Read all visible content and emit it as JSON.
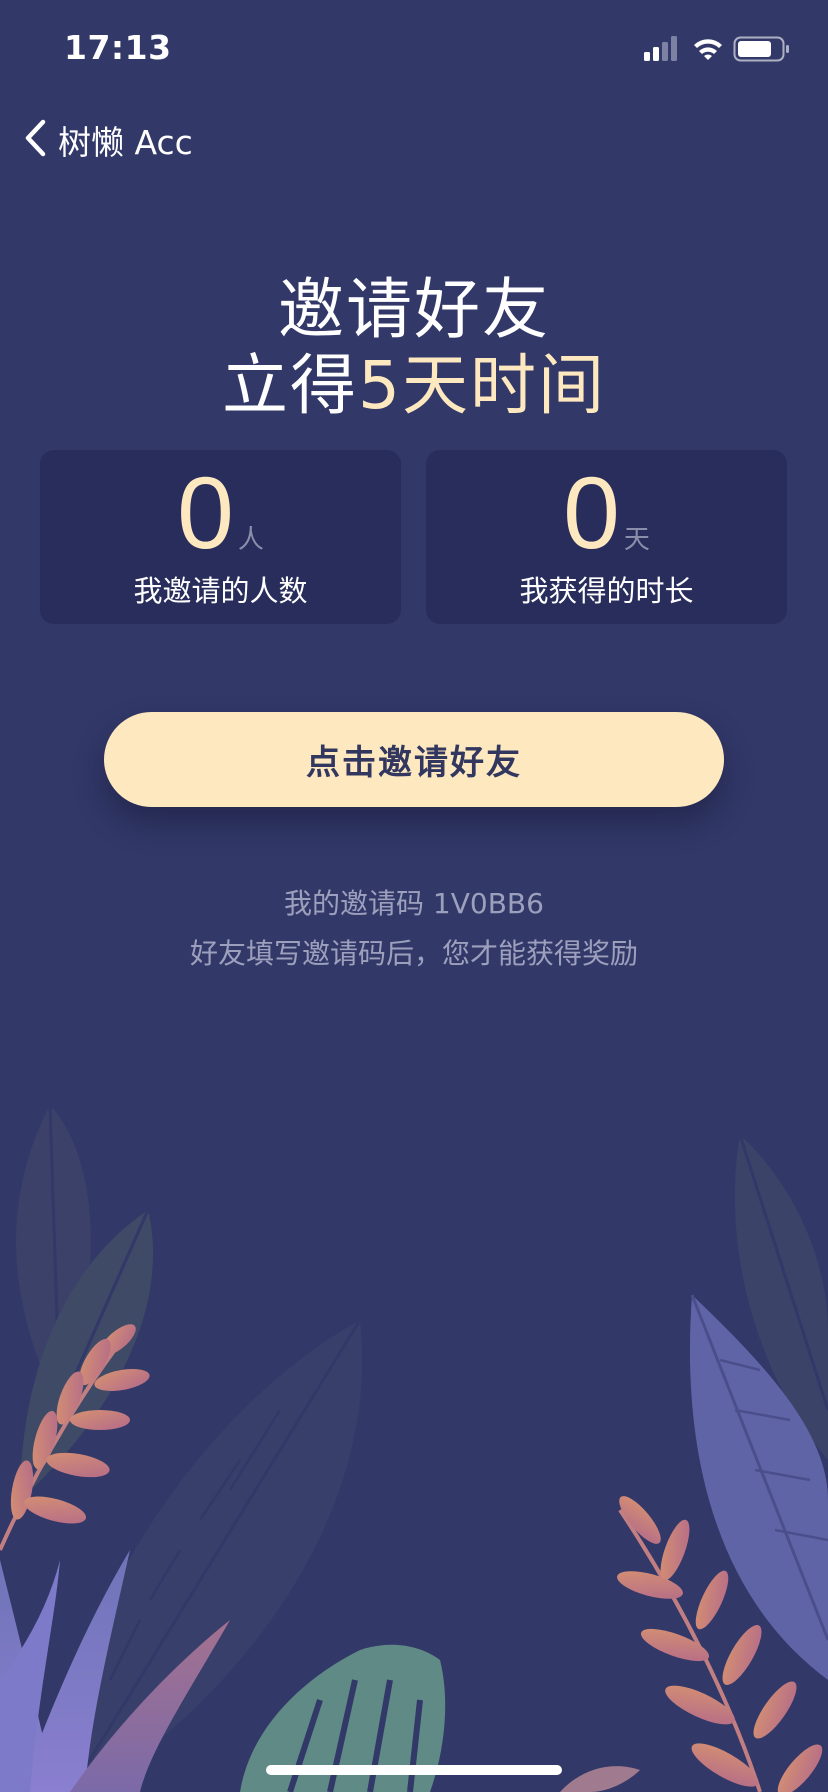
{
  "status_bar": {
    "time": "17:13",
    "icons": [
      "cellular-signal-icon",
      "wifi-icon",
      "battery-icon"
    ]
  },
  "nav": {
    "back_label": "树懒 Acc"
  },
  "headline": {
    "line1": "邀请好友",
    "line2_prefix": "立得",
    "line2_highlight": "5天时间"
  },
  "stats": {
    "invited": {
      "value": "0",
      "unit": "人",
      "label": "我邀请的人数"
    },
    "earned": {
      "value": "0",
      "unit": "天",
      "label": "我获得的时长"
    }
  },
  "invite_button": {
    "label": "点击邀请好友"
  },
  "invite_info": {
    "code_line": "我的邀请码 1V0BB6",
    "hint": "好友填写邀请码后，您才能获得奖励"
  },
  "colors": {
    "background": "#323868",
    "card": "#282d5c",
    "accent": "#fde8bf",
    "muted_text": "#9da0bd",
    "button_text": "#32375f"
  }
}
